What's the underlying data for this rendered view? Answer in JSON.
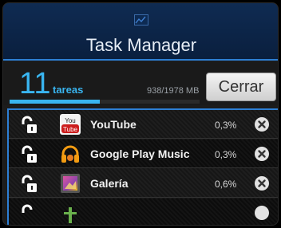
{
  "header": {
    "icon": "chart-icon",
    "title": "Task Manager"
  },
  "stats": {
    "task_count": "11",
    "task_label": "tareas",
    "memory": "938/1978 MB",
    "memory_used_fraction": 0.474,
    "close_label": "Cerrar"
  },
  "apps": [
    {
      "name": "YouTube",
      "cpu": "0,3%",
      "icon": "youtube-icon"
    },
    {
      "name": "Google Play Music",
      "cpu": "0,3%",
      "icon": "headphones-icon"
    },
    {
      "name": "Galería",
      "cpu": "0,6%",
      "icon": "gallery-icon"
    }
  ],
  "colors": {
    "accent": "#39b5f0",
    "header_bg": "#0f2b52",
    "border_blue": "#2d7fd4"
  }
}
